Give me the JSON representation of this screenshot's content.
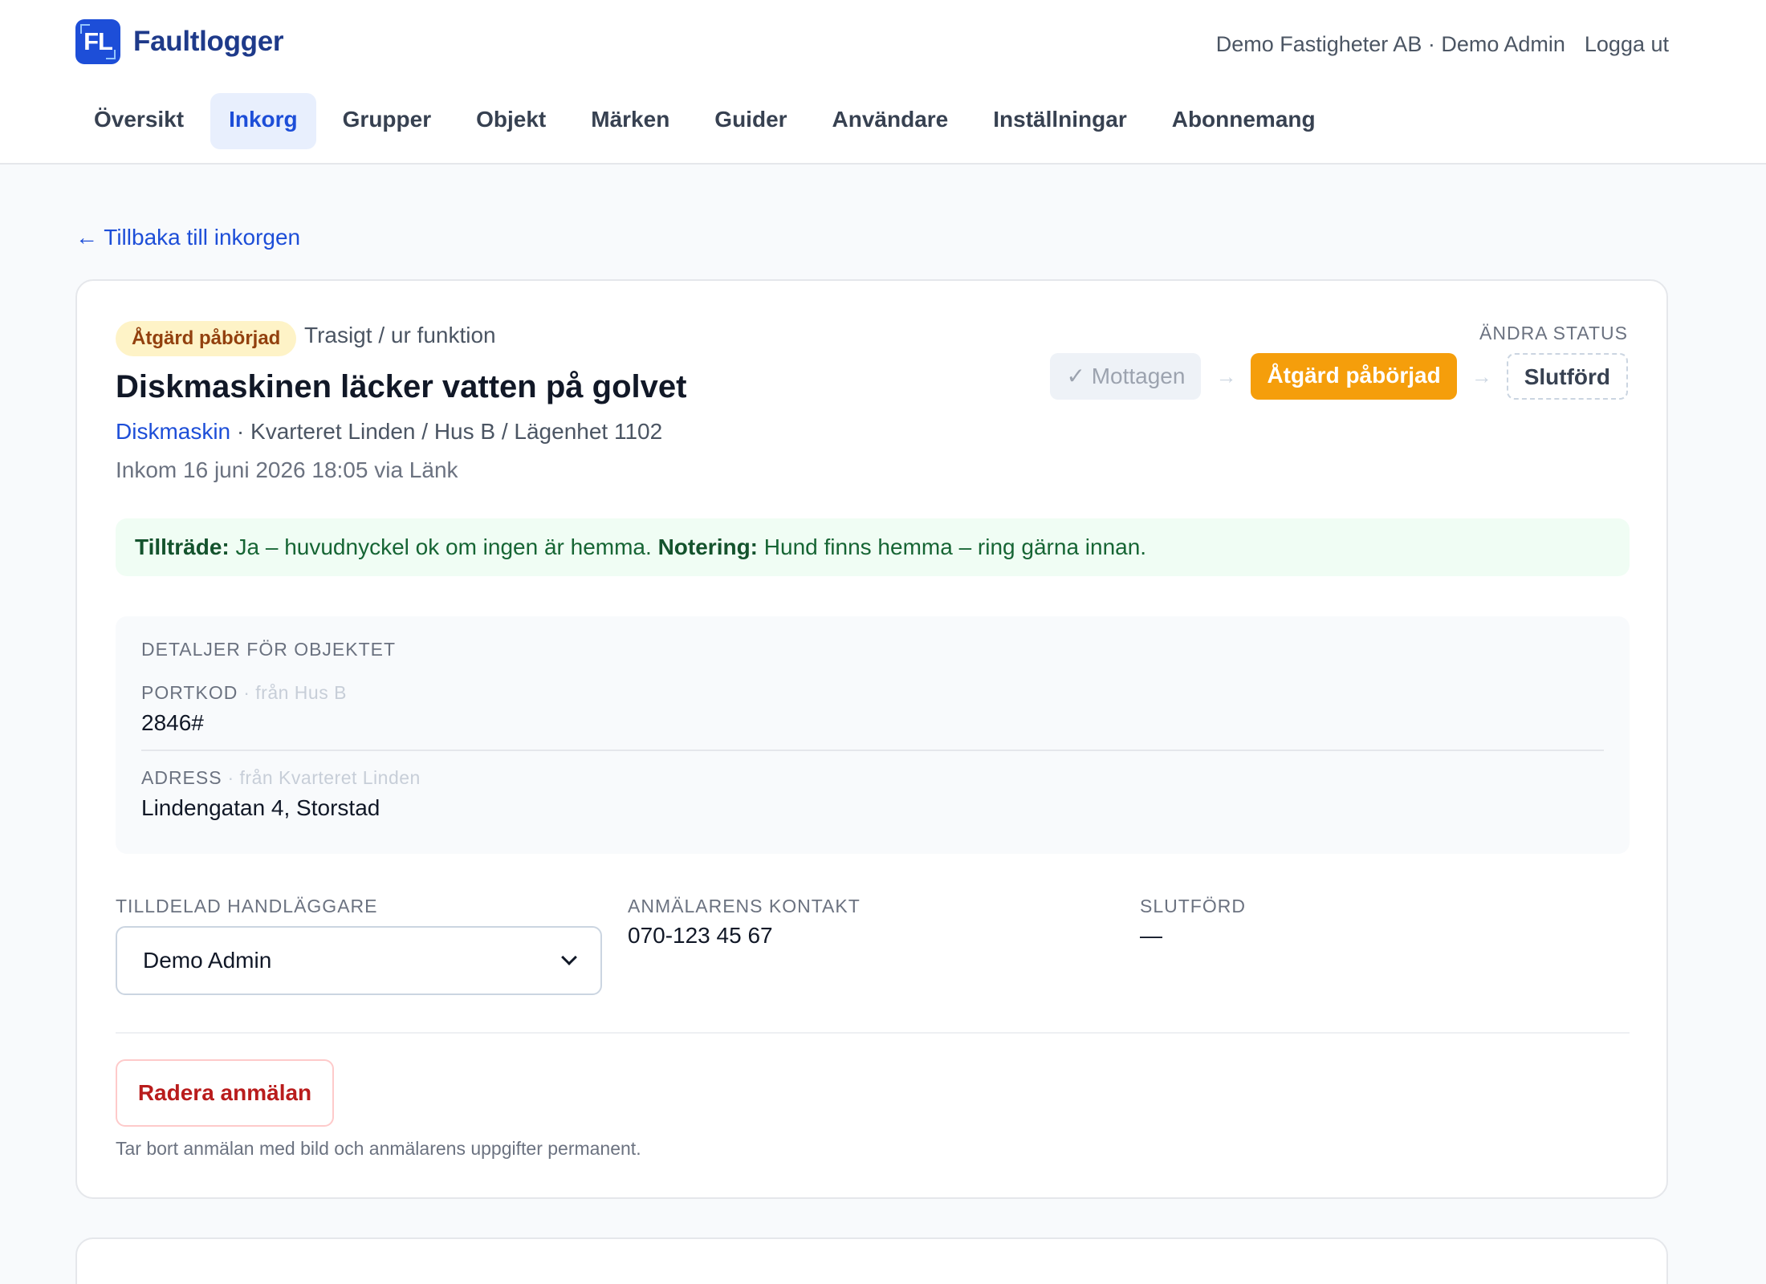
{
  "brand": {
    "logo_text": "FL",
    "name": "Faultlogger"
  },
  "account": {
    "org_user": "Demo Fastigheter AB · Demo Admin",
    "logout": "Logga ut"
  },
  "nav": [
    {
      "label": "Översikt"
    },
    {
      "label": "Inkorg",
      "active": true
    },
    {
      "label": "Grupper"
    },
    {
      "label": "Objekt"
    },
    {
      "label": "Märken"
    },
    {
      "label": "Guider"
    },
    {
      "label": "Användare"
    },
    {
      "label": "Inställningar"
    },
    {
      "label": "Abonnemang"
    }
  ],
  "back_link": "← Tillbaka till inkorgen",
  "report": {
    "status_badge": "Åtgärd påbörjad",
    "category": "Trasigt / ur funktion",
    "title": "Diskmaskinen läcker vatten på golvet",
    "object_link": "Diskmaskin",
    "location": " · Kvarteret Linden / Hus B / Lägenhet 1102",
    "incoming": "Inkom 16 juni 2026 18:05 via Länk"
  },
  "status_change": {
    "label": "ÄNDRA STATUS",
    "steps": [
      {
        "label": "✓ Mottagen",
        "state": "done"
      },
      {
        "label": "Åtgärd påbörjad",
        "state": "current"
      },
      {
        "label": "Slutförd",
        "state": "pending"
      }
    ],
    "arrow": "→"
  },
  "notice": {
    "access_label": "Tillträde:",
    "access_text": " Ja – huvudnyckel ok om ingen är hemma. ",
    "note_label": "Notering:",
    "note_text": " Hund finns hemma – ring gärna innan."
  },
  "details": {
    "heading": "DETALJER FÖR OBJEKTET",
    "rows": [
      {
        "label": "PORTKOD",
        "source": " · från Hus B",
        "value": "2846#"
      },
      {
        "label": "ADRESS",
        "source": " · från Kvarteret Linden",
        "value": "Lindengatan 4, Storstad"
      }
    ]
  },
  "assignee": {
    "label": "TILLDELAD HANDLÄGGARE",
    "value": "Demo Admin"
  },
  "reporter_contact": {
    "label": "ANMÄLARENS KONTAKT",
    "value": "070-123 45 67"
  },
  "completed": {
    "label": "SLUTFÖRD",
    "value": "—"
  },
  "delete": {
    "button": "Radera anmälan",
    "hint": "Tar bort anmälan med bild och anmälarens uppgifter permanent."
  },
  "colors": {
    "primary": "#1d4ed8",
    "current_status": "#f59e0b",
    "badge_bg": "#fef3c7",
    "notice_bg": "#f0fdf4",
    "danger": "#b91c1c"
  }
}
